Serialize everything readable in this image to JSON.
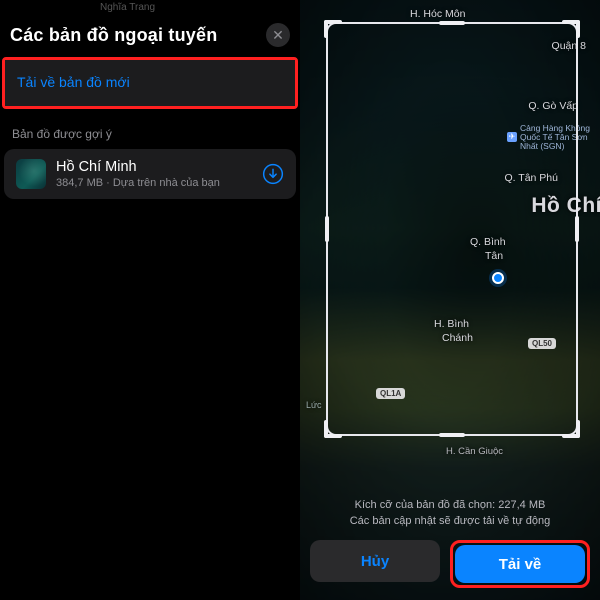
{
  "left": {
    "status_hint": "Nghĩa Trang",
    "title": "Các bản đồ ngoại tuyến",
    "download_new_label": "Tải về bản đồ mới",
    "suggested_label": "Bản đồ được gợi ý",
    "suggestion": {
      "title": "Hồ Chí Minh",
      "subtitle": "384,7 MB · Dựa trên nhà của bạn"
    }
  },
  "right": {
    "labels": {
      "hoc_mon": "H. Hóc Môn",
      "quan8": "Quận 8",
      "go_vap": "Q. Gò Vấp",
      "airport": "Cảng Hàng Không Quốc Tế Tân Sơn Nhất (SGN)",
      "tan_phu": "Q. Tân Phú",
      "city": "Hồ Chí",
      "binh_tan_1": "Q. Bình",
      "binh_tan_2": "Tân",
      "binh_chanh_1": "H. Bình",
      "binh_chanh_2": "Chánh",
      "can_giuoc": "H. Cần Giuộc",
      "ql50": "QL50",
      "ql1a": "QL1A",
      "luc": "Lức"
    },
    "sheet": {
      "line1": "Kích cỡ của bản đồ đã chọn: 227,4 MB",
      "line2": "Các bản cập nhật sẽ được tải về tự động",
      "cancel": "Hủy",
      "download": "Tải về"
    }
  }
}
